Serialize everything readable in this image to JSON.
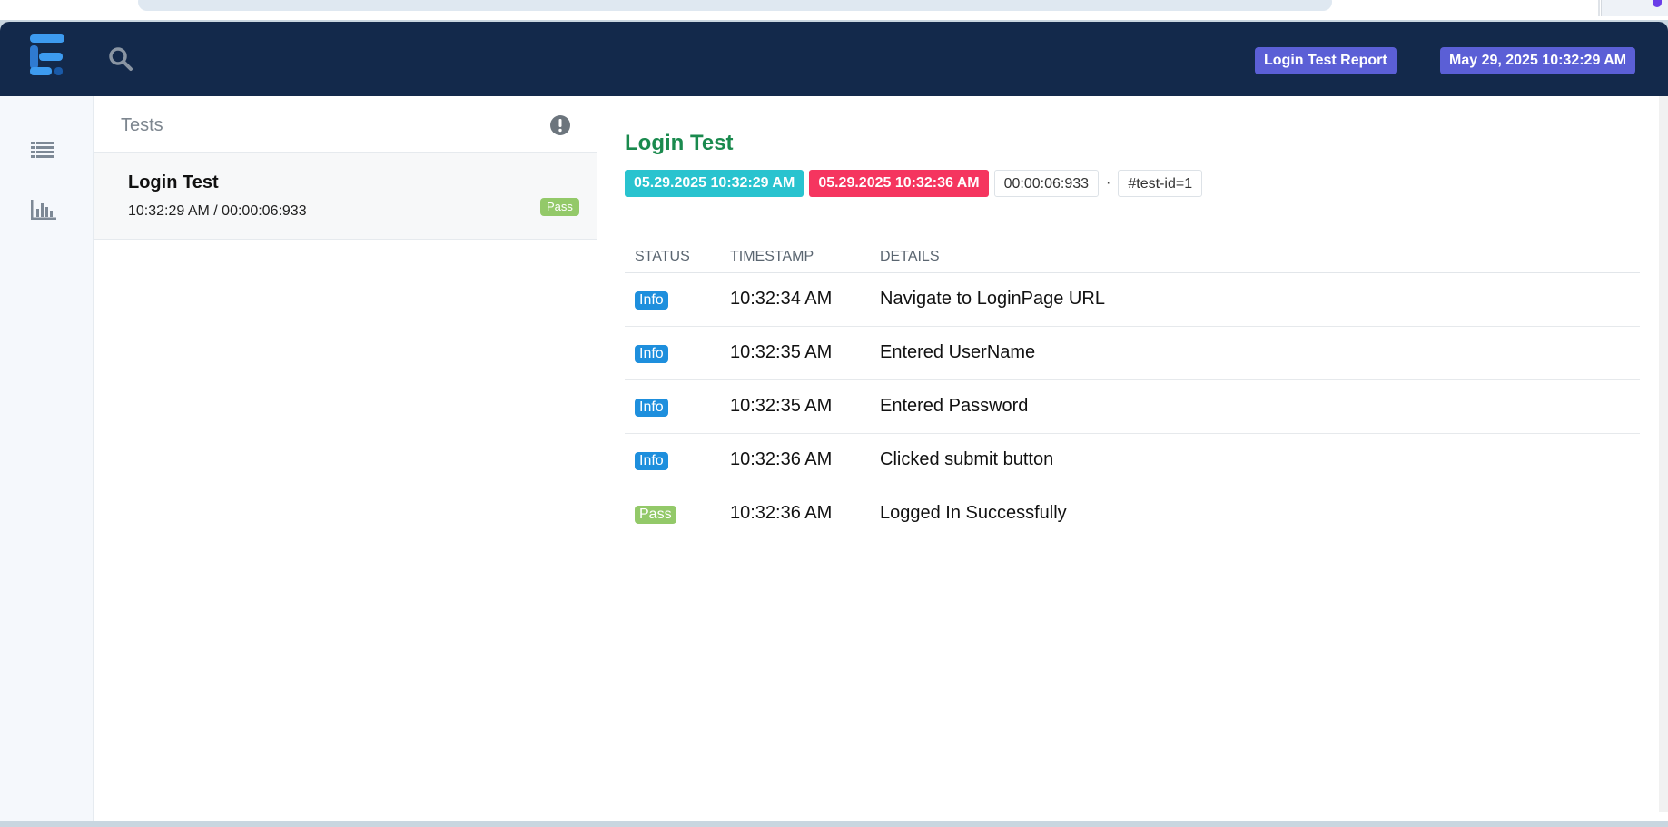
{
  "header": {
    "report_label": "Login Test Report",
    "date_label": "May 29, 2025 10:32:29 AM",
    "accent_color": "#5b5fd6",
    "bar_color": "#13294b"
  },
  "sidebar": {
    "items": [
      {
        "name": "test-list-view",
        "icon": "list-icon"
      },
      {
        "name": "dashboard-view",
        "icon": "bar-chart-icon"
      }
    ]
  },
  "tests_panel": {
    "title": "Tests",
    "items": [
      {
        "name": "Login Test",
        "meta": "10:32:29 AM / 00:00:06:933",
        "status": "Pass"
      }
    ]
  },
  "detail": {
    "title": "Login Test",
    "start": "05.29.2025 10:32:29 AM",
    "end": "05.29.2025 10:32:36 AM",
    "duration": "00:00:06:933",
    "separator": "·",
    "test_id": "#test-id=1",
    "columns": [
      "STATUS",
      "TIMESTAMP",
      "DETAILS"
    ],
    "logs": [
      {
        "status": "Info",
        "timestamp": "10:32:34 AM",
        "details": "Navigate to LoginPage URL"
      },
      {
        "status": "Info",
        "timestamp": "10:32:35 AM",
        "details": "Entered UserName"
      },
      {
        "status": "Info",
        "timestamp": "10:32:35 AM",
        "details": "Entered Password"
      },
      {
        "status": "Info",
        "timestamp": "10:32:36 AM",
        "details": "Clicked submit button"
      },
      {
        "status": "Pass",
        "timestamp": "10:32:36 AM",
        "details": "Logged In Successfully"
      }
    ]
  },
  "colors": {
    "pass": "#93c969",
    "info": "#1e8fdd",
    "start": "#29c3cf",
    "end": "#f5355f",
    "title": "#1a8a4e"
  }
}
